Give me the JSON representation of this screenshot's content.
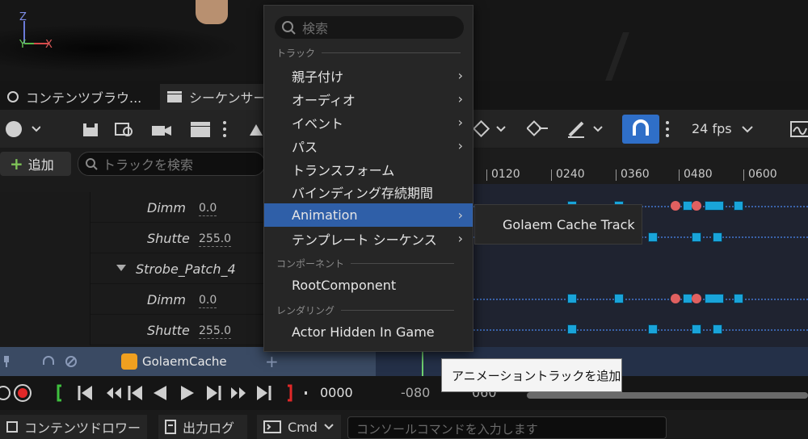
{
  "viewport": {
    "axis_z": "Z",
    "axis_y": "Y",
    "axis_x": "X"
  },
  "tabs": [
    {
      "label": "コンテンツブラウ..."
    },
    {
      "label": "シーケンサー"
    }
  ],
  "toolbar": {
    "fps": "24 fps"
  },
  "track_panel": {
    "add_label": "追加",
    "search_placeholder": "トラックを検索",
    "rows": [
      {
        "name": "Dimm",
        "value": "0.0"
      },
      {
        "name": "Shutte",
        "value": "255.0"
      },
      {
        "name": "Strobe_Patch_4",
        "value": ""
      },
      {
        "name": "Dimm",
        "value": "0.0"
      },
      {
        "name": "Shutte",
        "value": "255.0"
      }
    ],
    "golaem_label": "GolaemCache"
  },
  "timeline": {
    "ticks": [
      "0120",
      "0240",
      "0360",
      "0480",
      "0600"
    ]
  },
  "transport": {
    "frame": "0000",
    "start": "-080",
    "end": "060"
  },
  "bottom_bar": {
    "content_drawer": "コンテンツドロワー",
    "output_log": "出力ログ",
    "cmd": "Cmd",
    "console_placeholder": "コンソールコマンドを入力します"
  },
  "context_menu": {
    "search_placeholder": "検索",
    "section_track": "トラック",
    "items_track": [
      {
        "label": "親子付け",
        "submenu": true
      },
      {
        "label": "オーディオ",
        "submenu": true
      },
      {
        "label": "イベント",
        "submenu": true
      },
      {
        "label": "パス",
        "submenu": true
      },
      {
        "label": "トランスフォーム",
        "submenu": false
      },
      {
        "label": "バインディング存続期間",
        "submenu": false
      },
      {
        "label": "Animation",
        "submenu": true
      },
      {
        "label": "テンプレート シーケンス",
        "submenu": true
      }
    ],
    "section_component": "コンポーネント",
    "component_item": "RootComponent",
    "section_rendering": "レンダリング",
    "rendering_item": "Actor Hidden In Game",
    "submenu_item": "Golaem Cache Track",
    "tooltip": "アニメーショントラックを追加"
  },
  "colors": {
    "highlight": "#2f5fa8",
    "key_blue": "#19a4d9",
    "key_red": "#e06060",
    "selected_row": "#3a4a63"
  }
}
